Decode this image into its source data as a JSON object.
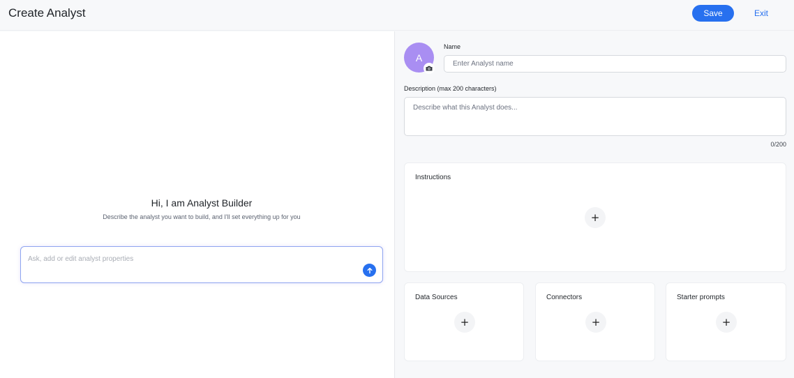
{
  "header": {
    "title": "Create Analyst",
    "save_label": "Save",
    "exit_label": "Exit"
  },
  "chat": {
    "greeting_title": "Hi, I am Analyst Builder",
    "greeting_subtitle": "Describe the analyst you want to build, and I'll set everything up for you",
    "input_placeholder": "Ask, add or edit analyst properties",
    "send_icon": "arrow-up-icon"
  },
  "config": {
    "avatar_letter": "A",
    "camera_icon": "camera-icon",
    "name_label": "Name",
    "name_placeholder": "Enter Analyst name",
    "name_value": "",
    "description_label": "Description (max 200 characters)",
    "description_placeholder": "Describe what this Analyst does...",
    "description_value": "",
    "char_count": "0/200",
    "instructions_title": "Instructions",
    "data_sources_title": "Data Sources",
    "connectors_title": "Connectors",
    "starter_prompts_title": "Starter prompts",
    "plus_symbol": "+"
  },
  "colors": {
    "accent": "#2770ef",
    "avatar": "#a98ef2",
    "background": "#f7f8fa"
  }
}
